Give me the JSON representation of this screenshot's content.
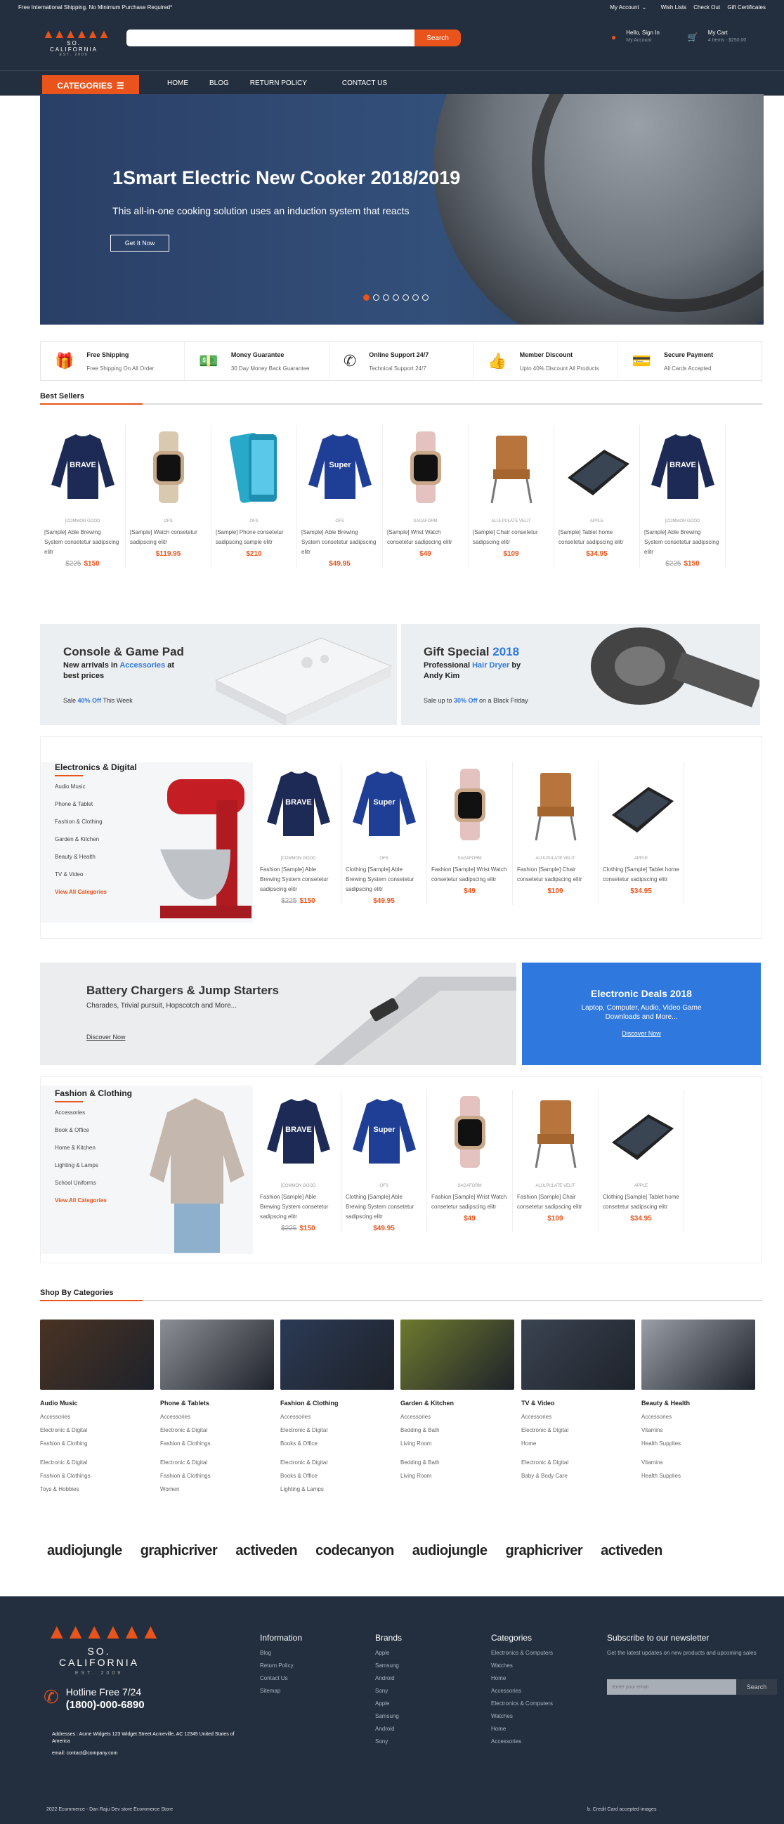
{
  "topbar": {
    "promo": "Free International Shipping. No Minimum Purchase Required*",
    "account": "My Account",
    "wishlists": "Wish Lists",
    "checkout": "Check Out",
    "gift": "Gift Certificates"
  },
  "logo": {
    "name": "SO. CALIFORNIA",
    "est": "EST. 2009"
  },
  "search": {
    "placeholder": "",
    "button": "Search"
  },
  "header": {
    "signin": "Hello, Sign In",
    "account": "My Account",
    "cart": "My Cart",
    "cart_info": "4 Items - $250.00"
  },
  "nav": {
    "categories": "CATEGORIES",
    "home": "HOME",
    "blog": "BLOG",
    "return": "RETURN POLICY",
    "contact": "CONTACT US"
  },
  "hero": {
    "title": "1Smart Electric New Cooker 2018/2019",
    "text": "This all-in-one cooking solution uses an induction system that reacts",
    "button": "Get It Now"
  },
  "features": [
    {
      "title": "Free Shipping",
      "sub": "Free Shipping On All Order",
      "icon": "gift-icon"
    },
    {
      "title": "Money Guarantee",
      "sub": "30 Day Money Back Guarantee",
      "icon": "money-icon"
    },
    {
      "title": "Online Support 24/7",
      "sub": "Technical Support 24/7",
      "icon": "phone-icon"
    },
    {
      "title": "Member Discount",
      "sub": "Upto 40% Discount All Products",
      "icon": "thumbs-up-icon"
    },
    {
      "title": "Secure Payment",
      "sub": "All Cards Accepted",
      "icon": "card-icon"
    }
  ],
  "bestsellers": {
    "title": "Best Sellers",
    "items": [
      {
        "brand": "[COMMON GOOD",
        "name": "[Sample] Able Brewing System consetetur sadipscing elitr",
        "old": "$225",
        "price": "$150",
        "kind": "shirt1"
      },
      {
        "brand": "OFS",
        "name": "[Sample] Watch consetetur sadipscing elitr",
        "old": "",
        "price": "$119.95",
        "kind": "watch1"
      },
      {
        "brand": "OFS",
        "name": "[Sample] Phone consetetur sadipscing sample elitr",
        "old": "",
        "price": "$210",
        "kind": "phone"
      },
      {
        "brand": "OFS",
        "name": "[Sample] Able Brewing System consetetur sadipscing elitr",
        "old": "",
        "price": "$49.95",
        "kind": "shirt2"
      },
      {
        "brand": "SAGAFORM",
        "name": "[Sample] Wrist Watch consetetur sadipscing elitr",
        "old": "",
        "price": "$49",
        "kind": "watch2"
      },
      {
        "brand": "ALULPULATE VELIT",
        "name": "[Sample] Chair consetetur sadipscing elitr",
        "old": "",
        "price": "$109",
        "kind": "chair"
      },
      {
        "brand": "APPLE",
        "name": "[Sample] Tablet home consetetur sadipscing elitr",
        "old": "",
        "price": "$34.95",
        "kind": "tablet"
      },
      {
        "brand": "[COMMON GOOD",
        "name": "[Sample] Able Brewing System consetetur sadipscing elitr",
        "old": "$225",
        "price": "$150",
        "kind": "shirt1"
      }
    ]
  },
  "promo1": {
    "title": "Console & Game Pad",
    "sub1": "New arrivals in ",
    "sub_hl": "Accessories",
    "sub2": " at best prices",
    "note1": "Sale ",
    "note_hl": "40% Off",
    "note2": " This Week"
  },
  "promo2": {
    "title": "Gift Special ",
    "title_hl": "2018",
    "sub1": "Professional ",
    "sub_hl": "Hair Dryer",
    "sub2": " by Andy Kim",
    "note1": "Sale up to ",
    "note_hl": "30% Off",
    "note2": " on a Black Friday"
  },
  "electronics": {
    "title": "Electronics & Digital",
    "items": [
      "Audio Music",
      "Phone & Tablet",
      "Fashion & Clothing",
      "Garden & Kitchen",
      "Beauty & Health",
      "TV & Video"
    ],
    "view": "View All Categories",
    "products": [
      {
        "brand": "[COMMON GOOD",
        "name": "Fashion [Sample] Able Brewing System consetetur sadipscing elitr",
        "old": "$225",
        "price": "$150",
        "kind": "shirt1"
      },
      {
        "brand": "OFS",
        "name": "Clothing [Sample] Able Brewing System consetetur sadipscing elitr",
        "old": "",
        "price": "$49.95",
        "kind": "shirt2"
      },
      {
        "brand": "SAGAFORM",
        "name": "Fashion [Sample] Wrist Watch consetetur sadipscing elitr",
        "old": "",
        "price": "$49",
        "kind": "watch2"
      },
      {
        "brand": "ALULPULATE VELIT",
        "name": "Fashion [Sample] Chair consetetur sadipscing elitr",
        "old": "",
        "price": "$109",
        "kind": "chair"
      },
      {
        "brand": "APPLE",
        "name": "Clothing [Sample] Tablet home consetetur sadipscing elitr",
        "old": "",
        "price": "$34.95",
        "kind": "tablet"
      }
    ]
  },
  "battery": {
    "title": "Battery Chargers & Jump Starters",
    "sub": "Charades, Trivial pursuit, Hopscotch and More...",
    "link": "Discover Now"
  },
  "edeals": {
    "title": "Electronic Deals 2018",
    "sub": "Laptop, Computer, Audio, Video Game Downloads and More...",
    "link": "Discover Now"
  },
  "fashion": {
    "title": "Fashion & Clothing",
    "items": [
      "Accessories",
      "Book & Office",
      "Home & Kitchen",
      "Lighting & Lamps",
      "School Uniforms"
    ],
    "view": "View All Categories",
    "products": [
      {
        "brand": "[COMMON GOOD",
        "name": "Fashion [Sample] Able Brewing System consetetur sadipscing elitr",
        "old": "$225",
        "price": "$150",
        "kind": "shirt1"
      },
      {
        "brand": "OFS",
        "name": "Clothing [Sample] Able Brewing System consetetur sadipscing elitr",
        "old": "",
        "price": "$49.95",
        "kind": "shirt2"
      },
      {
        "brand": "SAGAFORM",
        "name": "Fashion [Sample] Wrist Watch consetetur sadipscing elitr",
        "old": "",
        "price": "$49",
        "kind": "watch2"
      },
      {
        "brand": "ALULPULATE VELIT",
        "name": "Fashion [Sample] Chair consetetur sadipscing elitr",
        "old": "",
        "price": "$109",
        "kind": "chair"
      },
      {
        "brand": "APPLE",
        "name": "Clothing [Sample] Tablet home consetetur sadipscing elitr",
        "old": "",
        "price": "$34.95",
        "kind": "tablet"
      }
    ]
  },
  "shopcats": {
    "title": "Shop By Categories",
    "cats": [
      {
        "title": "Audio Music",
        "links": [
          "Accessories",
          "Electronic & Digital",
          "Fashion & Clothing",
          "",
          "Electronic & Digital",
          "Fashion & Clothings",
          "Toys & Hobbies"
        ],
        "color": "#4a3324"
      },
      {
        "title": "Phone & Tablets",
        "links": [
          "Accessories",
          "Electronic & Digital",
          "Fashion & Clothings",
          "",
          "Electronic & Digital",
          "Fashion & Clothings",
          "Women"
        ],
        "color": "#8c8f96"
      },
      {
        "title": "Fashion & Clothing",
        "links": [
          "Accessories",
          "Electronic & Digital",
          "Books & Office",
          "",
          "Electronic & Digital",
          "Books & Office",
          "Lighting & Lamps"
        ],
        "color": "#2b3a55"
      },
      {
        "title": "Garden & Kitchen",
        "links": [
          "Accessories",
          "Bedding & Bath",
          "Living Room",
          "",
          "Bedding & Bath",
          "Living Room"
        ],
        "color": "#6e7a2e"
      },
      {
        "title": "TV & Video",
        "links": [
          "Accessories",
          "Electronic & Digital",
          "Home",
          "",
          "Electronic & Digital",
          "Baby & Body Care"
        ],
        "color": "#3b4452"
      },
      {
        "title": "Beauty & Health",
        "links": [
          "Accessories",
          "Vitamins",
          "Health Supplies",
          "",
          "Vitamins",
          "Health Supplies"
        ],
        "color": "#9a9ea6"
      }
    ]
  },
  "brands_logos": [
    "audiojungle",
    "graphicriver",
    "activeden",
    "codecanyon",
    "audiojungle",
    "graphicriver",
    "activeden"
  ],
  "footer": {
    "hotline": "Hotline Free 7/24",
    "phone": "(1800)-000-6890",
    "address": "Addresses : Acme Widgets 123 Widget Street Acmeville, AC 12345 United States of America",
    "email": "email: contact@company.com",
    "info": {
      "title": "Information",
      "links": [
        "Blog",
        "Return Policy",
        "Contact Us",
        "Sitemap"
      ]
    },
    "brands": {
      "title": "Brands",
      "links": [
        "Apple",
        "Samsung",
        "Android",
        "Sony",
        "Apple",
        "Samsung",
        "Android",
        "Sony"
      ]
    },
    "cats": {
      "title": "Categories",
      "links": [
        "Electronics & Computers",
        "Watches",
        "Home",
        "Accessories",
        "Electronics & Computers",
        "Watches",
        "Home",
        "Accessories"
      ]
    },
    "newsletter": {
      "title": "Subscribe to our newsletter",
      "sub": "Get the latest updates on new products and upcoming sales",
      "placeholder": "Enter your email",
      "button": "Search"
    },
    "copyright": "2022 Ecommerce - Dan Raju Dev store Ecommerce Store",
    "cards": "Credit Card accepted images"
  },
  "colors": {
    "accent": "#e8541c",
    "dark": "#232f3e",
    "blue": "#2f78de"
  }
}
